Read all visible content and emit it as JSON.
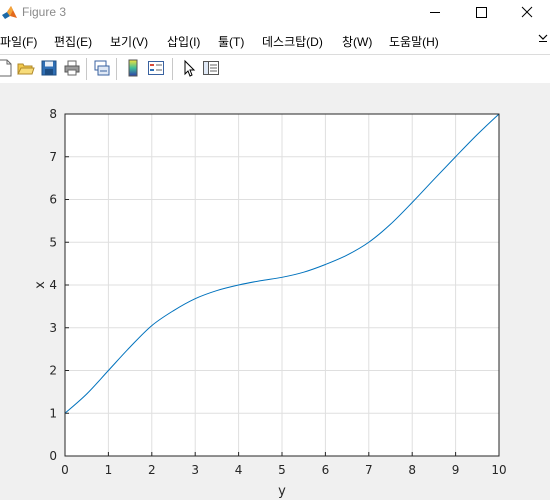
{
  "window": {
    "title": "Figure 3",
    "icon": "matlab-logo-icon",
    "controls": [
      "minimize-icon",
      "maximize-icon",
      "close-icon"
    ]
  },
  "menubar": {
    "items": [
      {
        "label": "파일(F)"
      },
      {
        "label": "편집(E)"
      },
      {
        "label": "보기(V)"
      },
      {
        "label": "삽입(I)"
      },
      {
        "label": "툴(T)"
      },
      {
        "label": "데스크탑(D)"
      },
      {
        "label": "창(W)"
      },
      {
        "label": "도움말(H)"
      }
    ],
    "overflow_icon": "menu-expand-arrow-icon"
  },
  "toolbar": {
    "buttons": [
      "new-figure-icon",
      "open-file-icon",
      "save-icon",
      "print-icon",
      "link-plot-icon",
      "colorbar-icon",
      "legend-icon",
      "select-pointer-icon",
      "property-inspector-icon"
    ]
  },
  "chart_data": {
    "type": "line",
    "title": "",
    "xlabel": "y",
    "ylabel": "x",
    "xlim": [
      0,
      10
    ],
    "ylim": [
      0,
      8
    ],
    "xticks": [
      "0",
      "1",
      "2",
      "3",
      "4",
      "5",
      "6",
      "7",
      "8",
      "9",
      "10"
    ],
    "yticks": [
      "0",
      "1",
      "2",
      "3",
      "4",
      "5",
      "6",
      "7",
      "8"
    ],
    "grid": true,
    "series": [
      {
        "color": "#0072bd",
        "x": [
          0,
          0.5,
          1,
          1.5,
          2,
          2.5,
          3,
          3.5,
          4,
          4.5,
          5,
          5.5,
          6,
          6.5,
          7,
          7.5,
          8,
          8.5,
          9,
          9.5,
          10
        ],
        "y": [
          1.0,
          1.45,
          2.0,
          2.55,
          3.05,
          3.4,
          3.68,
          3.87,
          4.0,
          4.1,
          4.18,
          4.3,
          4.48,
          4.7,
          5.0,
          5.42,
          5.93,
          6.47,
          7.0,
          7.52,
          8.0
        ]
      }
    ]
  }
}
